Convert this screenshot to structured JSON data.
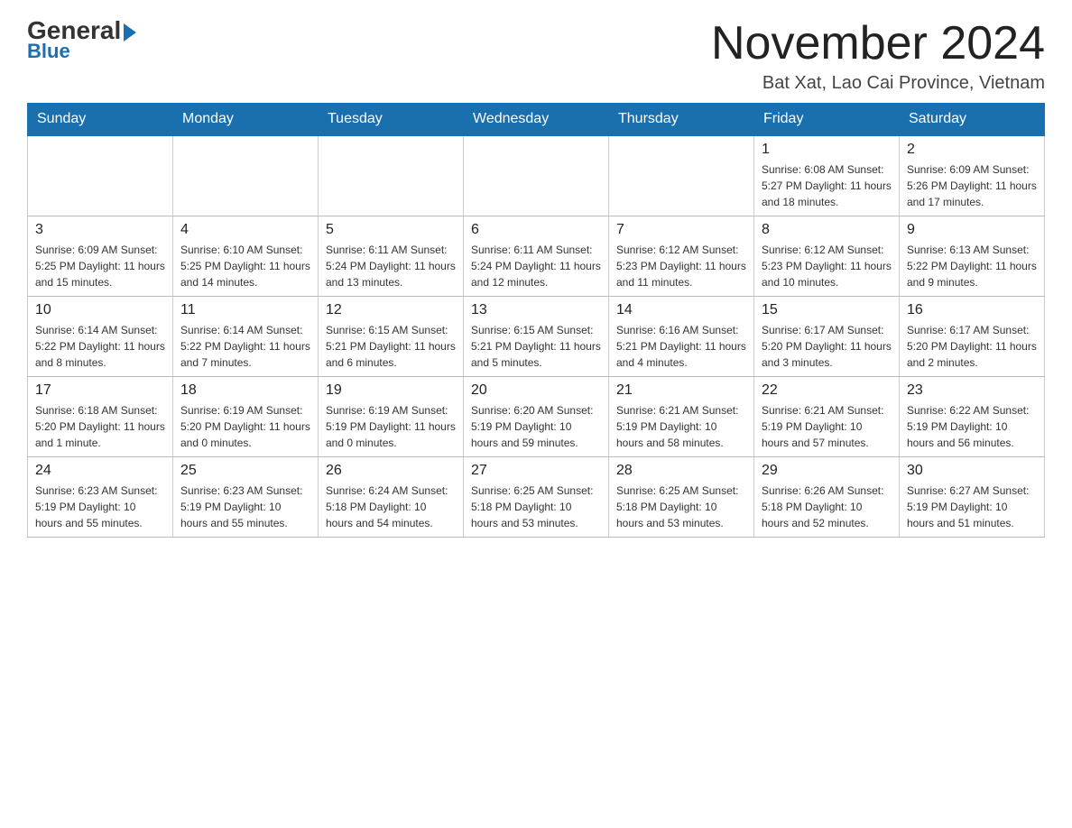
{
  "header": {
    "logo_general": "General",
    "logo_blue": "Blue",
    "month_title": "November 2024",
    "subtitle": "Bat Xat, Lao Cai Province, Vietnam"
  },
  "weekdays": [
    "Sunday",
    "Monday",
    "Tuesday",
    "Wednesday",
    "Thursday",
    "Friday",
    "Saturday"
  ],
  "weeks": [
    [
      {
        "day": "",
        "info": ""
      },
      {
        "day": "",
        "info": ""
      },
      {
        "day": "",
        "info": ""
      },
      {
        "day": "",
        "info": ""
      },
      {
        "day": "",
        "info": ""
      },
      {
        "day": "1",
        "info": "Sunrise: 6:08 AM\nSunset: 5:27 PM\nDaylight: 11 hours\nand 18 minutes."
      },
      {
        "day": "2",
        "info": "Sunrise: 6:09 AM\nSunset: 5:26 PM\nDaylight: 11 hours\nand 17 minutes."
      }
    ],
    [
      {
        "day": "3",
        "info": "Sunrise: 6:09 AM\nSunset: 5:25 PM\nDaylight: 11 hours\nand 15 minutes."
      },
      {
        "day": "4",
        "info": "Sunrise: 6:10 AM\nSunset: 5:25 PM\nDaylight: 11 hours\nand 14 minutes."
      },
      {
        "day": "5",
        "info": "Sunrise: 6:11 AM\nSunset: 5:24 PM\nDaylight: 11 hours\nand 13 minutes."
      },
      {
        "day": "6",
        "info": "Sunrise: 6:11 AM\nSunset: 5:24 PM\nDaylight: 11 hours\nand 12 minutes."
      },
      {
        "day": "7",
        "info": "Sunrise: 6:12 AM\nSunset: 5:23 PM\nDaylight: 11 hours\nand 11 minutes."
      },
      {
        "day": "8",
        "info": "Sunrise: 6:12 AM\nSunset: 5:23 PM\nDaylight: 11 hours\nand 10 minutes."
      },
      {
        "day": "9",
        "info": "Sunrise: 6:13 AM\nSunset: 5:22 PM\nDaylight: 11 hours\nand 9 minutes."
      }
    ],
    [
      {
        "day": "10",
        "info": "Sunrise: 6:14 AM\nSunset: 5:22 PM\nDaylight: 11 hours\nand 8 minutes."
      },
      {
        "day": "11",
        "info": "Sunrise: 6:14 AM\nSunset: 5:22 PM\nDaylight: 11 hours\nand 7 minutes."
      },
      {
        "day": "12",
        "info": "Sunrise: 6:15 AM\nSunset: 5:21 PM\nDaylight: 11 hours\nand 6 minutes."
      },
      {
        "day": "13",
        "info": "Sunrise: 6:15 AM\nSunset: 5:21 PM\nDaylight: 11 hours\nand 5 minutes."
      },
      {
        "day": "14",
        "info": "Sunrise: 6:16 AM\nSunset: 5:21 PM\nDaylight: 11 hours\nand 4 minutes."
      },
      {
        "day": "15",
        "info": "Sunrise: 6:17 AM\nSunset: 5:20 PM\nDaylight: 11 hours\nand 3 minutes."
      },
      {
        "day": "16",
        "info": "Sunrise: 6:17 AM\nSunset: 5:20 PM\nDaylight: 11 hours\nand 2 minutes."
      }
    ],
    [
      {
        "day": "17",
        "info": "Sunrise: 6:18 AM\nSunset: 5:20 PM\nDaylight: 11 hours\nand 1 minute."
      },
      {
        "day": "18",
        "info": "Sunrise: 6:19 AM\nSunset: 5:20 PM\nDaylight: 11 hours\nand 0 minutes."
      },
      {
        "day": "19",
        "info": "Sunrise: 6:19 AM\nSunset: 5:19 PM\nDaylight: 11 hours\nand 0 minutes."
      },
      {
        "day": "20",
        "info": "Sunrise: 6:20 AM\nSunset: 5:19 PM\nDaylight: 10 hours\nand 59 minutes."
      },
      {
        "day": "21",
        "info": "Sunrise: 6:21 AM\nSunset: 5:19 PM\nDaylight: 10 hours\nand 58 minutes."
      },
      {
        "day": "22",
        "info": "Sunrise: 6:21 AM\nSunset: 5:19 PM\nDaylight: 10 hours\nand 57 minutes."
      },
      {
        "day": "23",
        "info": "Sunrise: 6:22 AM\nSunset: 5:19 PM\nDaylight: 10 hours\nand 56 minutes."
      }
    ],
    [
      {
        "day": "24",
        "info": "Sunrise: 6:23 AM\nSunset: 5:19 PM\nDaylight: 10 hours\nand 55 minutes."
      },
      {
        "day": "25",
        "info": "Sunrise: 6:23 AM\nSunset: 5:19 PM\nDaylight: 10 hours\nand 55 minutes."
      },
      {
        "day": "26",
        "info": "Sunrise: 6:24 AM\nSunset: 5:18 PM\nDaylight: 10 hours\nand 54 minutes."
      },
      {
        "day": "27",
        "info": "Sunrise: 6:25 AM\nSunset: 5:18 PM\nDaylight: 10 hours\nand 53 minutes."
      },
      {
        "day": "28",
        "info": "Sunrise: 6:25 AM\nSunset: 5:18 PM\nDaylight: 10 hours\nand 53 minutes."
      },
      {
        "day": "29",
        "info": "Sunrise: 6:26 AM\nSunset: 5:18 PM\nDaylight: 10 hours\nand 52 minutes."
      },
      {
        "day": "30",
        "info": "Sunrise: 6:27 AM\nSunset: 5:19 PM\nDaylight: 10 hours\nand 51 minutes."
      }
    ]
  ]
}
